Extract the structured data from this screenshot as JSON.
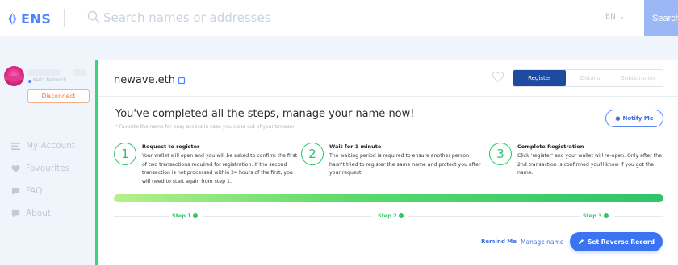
{
  "header": {
    "logo_text": "ENS",
    "search_placeholder": "Search names or addresses",
    "language": "EN ⌄",
    "search_button": "Search"
  },
  "sidebar": {
    "network_label": "Main Network",
    "disconnect_label": "Disconnect",
    "items": [
      {
        "label": "My Account",
        "icon": "account-icon"
      },
      {
        "label": "Favourites",
        "icon": "heart-icon"
      },
      {
        "label": "FAQ",
        "icon": "chat-icon"
      },
      {
        "label": "About",
        "icon": "info-chat-icon"
      }
    ]
  },
  "card": {
    "domain": "newave.eth",
    "tabs": [
      {
        "label": "Register",
        "active": true
      },
      {
        "label": "Details",
        "active": false
      },
      {
        "label": "Subdomains",
        "active": false
      }
    ],
    "headline": "You've completed all the steps, manage your name now!",
    "note": "* Favorite the name for easy access in case you close out of your browser.",
    "notify_label": "Notify Me",
    "steps": [
      {
        "number": "1",
        "title": "Request to register",
        "body": "Your wallet will open and you will be asked to confirm the first of two transactions required for registration. If the second transaction is not processed within 24 hours of the first, you will need to start again from step 1."
      },
      {
        "number": "2",
        "title": "Wait for 1 minute",
        "body": "The waiting period is required to ensure another person hasn't tried to register the same name and protect you after your request."
      },
      {
        "number": "3",
        "title": "Complete Registration",
        "body": "Click 'register' and your wallet will re-open. Only after the 2nd transaction is confirmed you'll know if you got the name."
      }
    ],
    "progress_fraction": 1.0,
    "step_labels": [
      "Step 1",
      "Step 2",
      "Step 3"
    ],
    "remind_label": "Remind Me",
    "manage_label": "Manage name",
    "reverse_label": "Set Reverse Record"
  },
  "colors": {
    "brand": "#5284ff",
    "accent_green": "#2fc26e",
    "primary_button": "#3c73f0",
    "tab_active": "#1e4ba0",
    "disconnect": "#f0763a"
  }
}
